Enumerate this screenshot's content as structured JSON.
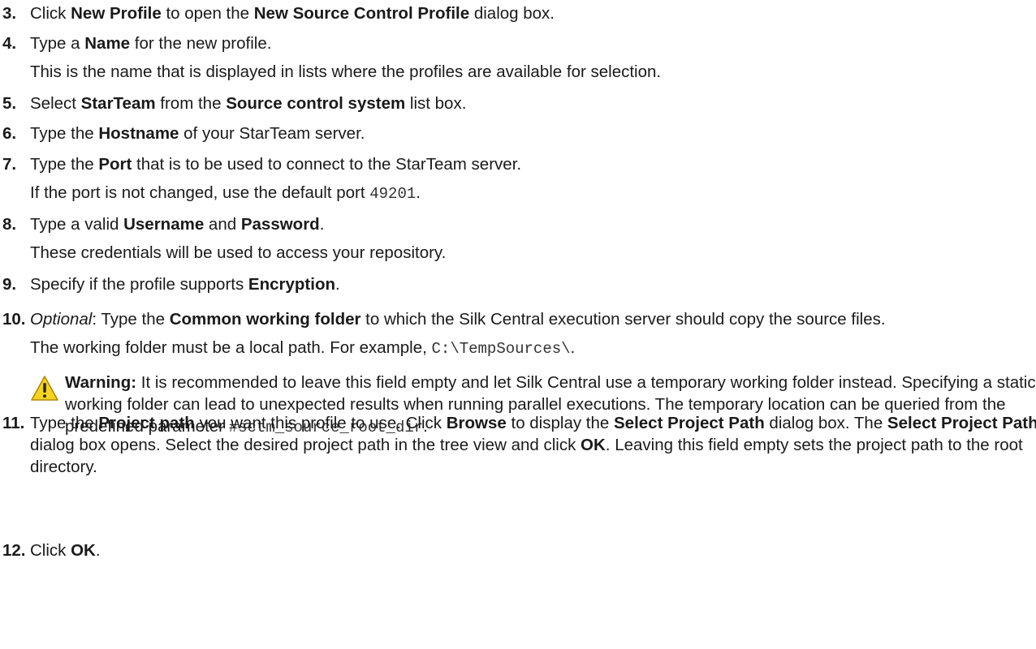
{
  "steps": [
    {
      "num": "3.",
      "parts": [
        {
          "t": "Click "
        },
        {
          "b": "New Profile"
        },
        {
          "t": " to open the "
        },
        {
          "b": "New Source Control Profile"
        },
        {
          "t": " dialog box."
        }
      ]
    },
    {
      "num": "4.",
      "parts": [
        {
          "t": "Type a "
        },
        {
          "b": "Name"
        },
        {
          "t": " for the new profile."
        }
      ],
      "note": [
        {
          "t": "This is the name that is displayed in lists where the profiles are available for selection."
        }
      ]
    },
    {
      "num": "5.",
      "parts": [
        {
          "t": "Select "
        },
        {
          "b": "StarTeam"
        },
        {
          "t": " from the "
        },
        {
          "b": "Source control system"
        },
        {
          "t": " list box."
        }
      ]
    },
    {
      "num": "6.",
      "parts": [
        {
          "t": "Type the "
        },
        {
          "b": "Hostname"
        },
        {
          "t": " of your StarTeam server."
        }
      ]
    },
    {
      "num": "7.",
      "parts": [
        {
          "t": "Type the "
        },
        {
          "b": "Port"
        },
        {
          "t": " that is to be used to connect to the StarTeam server."
        }
      ],
      "note": [
        {
          "t": "If the port is not changed, use the default port "
        },
        {
          "c": "49201"
        },
        {
          "t": "."
        }
      ]
    },
    {
      "num": "8.",
      "parts": [
        {
          "t": "Type a valid "
        },
        {
          "b": "Username"
        },
        {
          "t": " and "
        },
        {
          "b": "Password"
        },
        {
          "t": "."
        }
      ],
      "note": [
        {
          "t": "These credentials will be used to access your repository."
        }
      ]
    },
    {
      "num": "9.",
      "parts": [
        {
          "t": "Specify if the profile supports "
        },
        {
          "b": "Encryption"
        },
        {
          "t": "."
        }
      ]
    },
    {
      "num": "10.",
      "parts": [
        {
          "i": "Optional"
        },
        {
          "t": ": Type the "
        },
        {
          "b": "Common working folder"
        },
        {
          "t": " to which the Silk Central execution server should copy the source files."
        }
      ],
      "note": [
        {
          "t": "The working folder must be a local path. For example, "
        },
        {
          "c": "C:\\TempSources\\"
        },
        {
          "t": "."
        }
      ],
      "warning": {
        "head": "Warning:",
        "parts": [
          {
            "t": " It is recommended to leave this field empty and let Silk Central use a temporary working folder instead. Specifying a static working folder can lead to unexpected results when running parallel executions. The temporary location can be queried from the predefined parameter "
          },
          {
            "c": "#sctm_source_root_dir"
          },
          {
            "t": "."
          }
        ]
      }
    },
    {
      "num": "11.",
      "parts": [
        {
          "t": "Type the "
        },
        {
          "b": "Project path"
        },
        {
          "t": " you want this profile to use. Click "
        },
        {
          "b": "Browse"
        },
        {
          "t": " to display the "
        },
        {
          "b": "Select Project Path"
        },
        {
          "t": " dialog box. The "
        },
        {
          "b": "Select Project Path"
        },
        {
          "t": " dialog box opens. Select the desired project path in the tree view and click "
        },
        {
          "b": "OK"
        },
        {
          "t": ". Leaving this field empty sets the project path to the root directory."
        }
      ]
    },
    {
      "num": "12.",
      "parts": [
        {
          "t": "Click "
        },
        {
          "b": "OK"
        },
        {
          "t": "."
        }
      ]
    }
  ],
  "icons": {
    "warning": "warning-triangle-icon"
  },
  "colors": {
    "warning_fill": "#f5d320",
    "warning_stroke": "#b08a00"
  }
}
